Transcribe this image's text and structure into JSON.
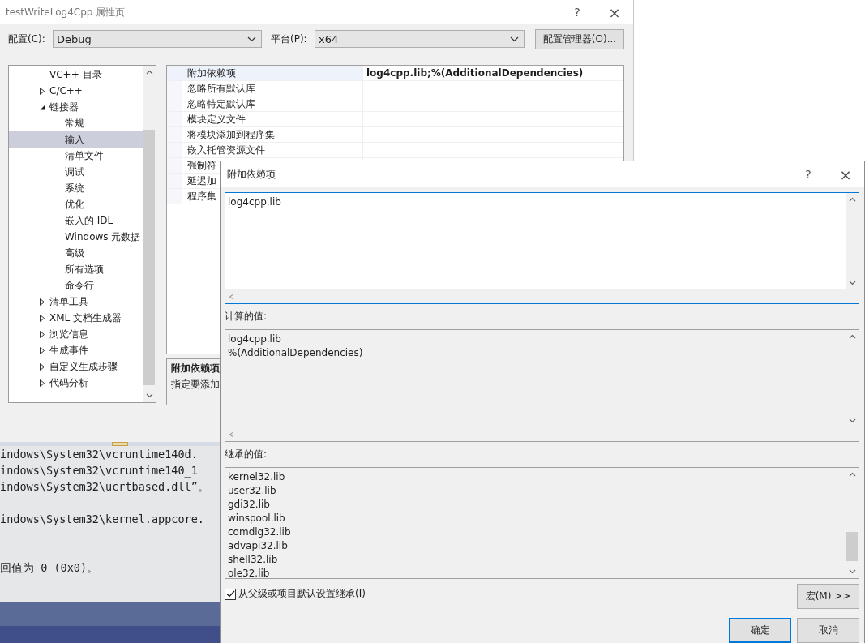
{
  "property_window": {
    "title": "testWriteLog4Cpp 属性页",
    "help": "?",
    "close": "×",
    "config": {
      "label": "配置(C):",
      "value": "Debug"
    },
    "platform": {
      "label": "平台(P):",
      "value": "x64"
    },
    "config_manager_button": "配置管理器(O)...",
    "tree": [
      {
        "label": "VC++ 目录",
        "selected": false
      },
      {
        "label": "C/C++",
        "selected": false,
        "expanded": false
      },
      {
        "label": "链接器",
        "selected": false,
        "expanded": true,
        "children": [
          {
            "label": "常规",
            "selected": false
          },
          {
            "label": "输入",
            "selected": true
          },
          {
            "label": "清单文件",
            "selected": false
          },
          {
            "label": "调试",
            "selected": false
          },
          {
            "label": "系统",
            "selected": false
          },
          {
            "label": "优化",
            "selected": false
          },
          {
            "label": "嵌入的 IDL",
            "selected": false
          },
          {
            "label": "Windows 元数据",
            "selected": false
          },
          {
            "label": "高级",
            "selected": false
          },
          {
            "label": "所有选项",
            "selected": false
          },
          {
            "label": "命令行",
            "selected": false
          }
        ]
      },
      {
        "label": "清单工具",
        "selected": false,
        "expanded": false
      },
      {
        "label": "XML 文档生成器",
        "selected": false,
        "expanded": false
      },
      {
        "label": "浏览信息",
        "selected": false,
        "expanded": false
      },
      {
        "label": "生成事件",
        "selected": false,
        "expanded": false
      },
      {
        "label": "自定义生成步骤",
        "selected": false,
        "expanded": false
      },
      {
        "label": "代码分析",
        "selected": false,
        "expanded": false
      }
    ],
    "properties": [
      {
        "name": "附加依赖项",
        "value": "log4cpp.lib;%(AdditionalDependencies)",
        "selected": true
      },
      {
        "name": "忽略所有默认库",
        "selected": false
      },
      {
        "name": "忽略特定默认库",
        "selected": false
      },
      {
        "name": "模块定义文件",
        "selected": false
      },
      {
        "name": "将模块添加到程序集",
        "selected": false
      },
      {
        "name": "嵌入托管资源文件",
        "selected": false
      },
      {
        "name": "强制符",
        "selected": false
      },
      {
        "name": "延迟加",
        "selected": false
      },
      {
        "name": "程序集",
        "selected": false
      }
    ],
    "description": {
      "title": "附加依赖项",
      "text": "指定要添加"
    }
  },
  "output": {
    "lines": [
      "indows\\System32\\vcruntime140d.",
      "indows\\System32\\vcruntime140_1",
      "indows\\System32\\ucrtbased.dll”。",
      "indows\\System32\\kernel.appcore.",
      "回值为 0 (0x0)。"
    ]
  },
  "dialog": {
    "title": "附加依赖项",
    "help": "?",
    "close": "×",
    "edit_value": "log4cpp.lib",
    "computed": {
      "label": "计算的值:",
      "lines": [
        "log4cpp.lib",
        "%(AdditionalDependencies)"
      ]
    },
    "inherited": {
      "label": "继承的值:",
      "lines": [
        "kernel32.lib",
        "user32.lib",
        "gdi32.lib",
        "winspool.lib",
        "comdlg32.lib",
        "advapi32.lib",
        "shell32.lib",
        "ole32.lib"
      ]
    },
    "inherit_checkbox": {
      "label": "从父级或项目默认设置继承(I)",
      "checked": true
    },
    "macro_button": "宏(M) >>",
    "ok_button": "确定",
    "cancel_button": "取消"
  }
}
